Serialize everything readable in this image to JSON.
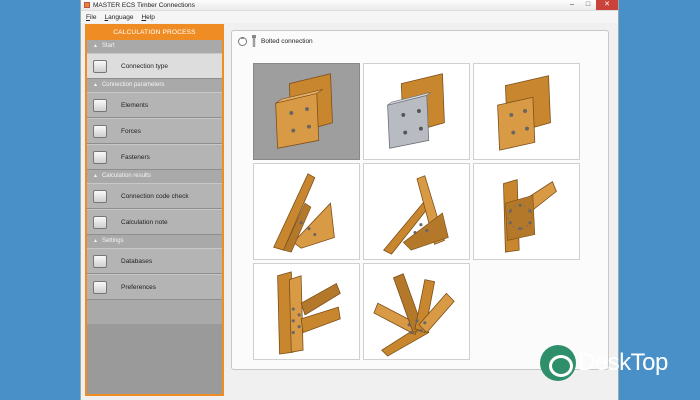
{
  "window": {
    "title": "MASTER ECS Timber Connections",
    "controls": [
      "–",
      "□",
      "✕"
    ]
  },
  "menu": [
    "File",
    "Language",
    "Help"
  ],
  "sidebar": {
    "header": "CALCULATION PROCESS",
    "sections": [
      {
        "label": "Start",
        "items": [
          {
            "label": "Connection type",
            "icon": "connection-type-icon",
            "selected": true
          }
        ]
      },
      {
        "label": "Connection parameters",
        "items": [
          {
            "label": "Elements",
            "icon": "elements-icon"
          },
          {
            "label": "Forces",
            "icon": "forces-icon"
          },
          {
            "label": "Fasteners",
            "icon": "fasteners-icon"
          }
        ]
      },
      {
        "label": "Calculation results",
        "items": [
          {
            "label": "Connection code check",
            "icon": "code-check-icon"
          },
          {
            "label": "Calculation note",
            "icon": "calculation-note-icon"
          }
        ]
      },
      {
        "label": "Settings",
        "items": [
          {
            "label": "Databases",
            "icon": "database-icon"
          },
          {
            "label": "Preferences",
            "icon": "preferences-icon"
          }
        ]
      }
    ]
  },
  "main": {
    "group_title": "Bolted connection",
    "tiles": [
      {
        "type": "timber-plate",
        "selected": true
      },
      {
        "type": "steel-plate"
      },
      {
        "type": "timber-side"
      },
      {
        "type": "truss-left"
      },
      {
        "type": "truss-center"
      },
      {
        "type": "knee-ring"
      },
      {
        "type": "multi-member"
      },
      {
        "type": "fan-member"
      }
    ]
  },
  "watermark": "DeskTop",
  "colors": {
    "accent": "#f08c24",
    "timber": "#c8872e",
    "timber_dark": "#8a5a1a",
    "steel": "#b8bcc2"
  }
}
